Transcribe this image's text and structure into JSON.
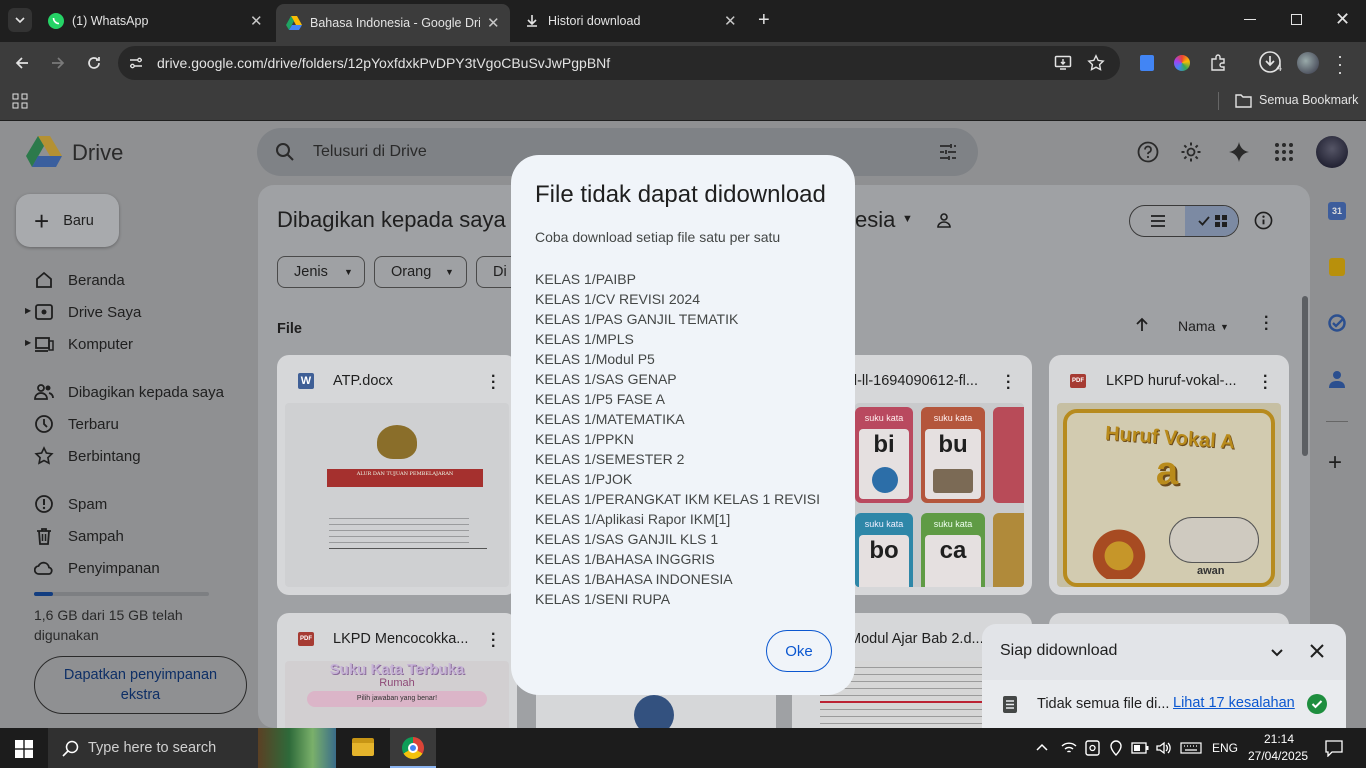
{
  "browser": {
    "tabs": [
      {
        "title": "(1) WhatsApp",
        "icon": "whatsapp-icon"
      },
      {
        "title": "Bahasa Indonesia - Google Driv",
        "icon": "google-drive-icon"
      },
      {
        "title": "Histori download",
        "icon": "download-icon"
      }
    ],
    "url": "drive.google.com/drive/folders/12pYoxfdxkPvDPY3tVgoCBuSvJwPgpBNf",
    "download_badge": "4",
    "bookmarks_label": "Semua Bookmark"
  },
  "drive": {
    "logo_text": "Drive",
    "search_placeholder": "Telusuri di Drive",
    "new_button": "Baru",
    "nav": [
      {
        "label": "Beranda",
        "icon": "home-icon"
      },
      {
        "label": "Drive Saya",
        "icon": "my-drive-icon"
      },
      {
        "label": "Komputer",
        "icon": "computer-icon"
      },
      {
        "label": "Dibagikan kepada saya",
        "icon": "shared-icon"
      },
      {
        "label": "Terbaru",
        "icon": "clock-icon"
      },
      {
        "label": "Berbintang",
        "icon": "star-icon"
      },
      {
        "label": "Spam",
        "icon": "spam-icon"
      },
      {
        "label": "Sampah",
        "icon": "trash-icon"
      },
      {
        "label": "Penyimpanan",
        "icon": "cloud-icon"
      }
    ],
    "storage_text": "1,6 GB dari 15 GB telah digunakan",
    "storage_fraction": 0.107,
    "storage_button": "Dapatkan penyimpanan ekstra",
    "breadcrumb_left": "Dibagikan kepada saya",
    "breadcrumb_right": "esia",
    "filters": [
      "Jenis",
      "Orang",
      "Di"
    ],
    "section_title": "File",
    "sort_label": "Nama",
    "files": [
      {
        "name": "ATP.docx",
        "type": "W"
      },
      {
        "name": "d-ll-1694090612-fl...",
        "type": ""
      },
      {
        "name": "LKPD huruf-vokal-...",
        "type": "PDF"
      },
      {
        "name": "LKPD Mencocokka...",
        "type": "PDF"
      },
      {
        "name": "Modul Ajar Bab 2.d...",
        "type": ""
      }
    ],
    "thumb_text": {
      "atp_line": "ALUR DAN TUJUAN PEMBELAJARAN",
      "syllables": [
        "bi",
        "bu",
        "bo",
        "ca"
      ],
      "syllable_tag": "suku kata",
      "vokal_title": "Huruf Vokal A",
      "vokal_letter": "a",
      "vokal_word": "awan",
      "mencocok_title": "Suku Kata Terbuka",
      "mencocok_sub": "Rumah",
      "mencocok_hint": "Pilih jawaban yang benar!"
    }
  },
  "dialog": {
    "title": "File tidak dapat didownload",
    "subtitle": "Coba download setiap file satu per satu",
    "items": [
      "KELAS 1/PAIBP",
      "KELAS 1/CV REVISI 2024",
      "KELAS 1/PAS GANJIL TEMATIK",
      "KELAS 1/MPLS",
      "KELAS 1/Modul P5",
      "KELAS 1/SAS GENAP",
      "KELAS 1/P5 FASE A",
      "KELAS 1/MATEMATIKA",
      "KELAS 1/PPKN",
      "KELAS 1/SEMESTER 2",
      "KELAS 1/PJOK",
      "KELAS 1/PERANGKAT IKM KELAS 1 REVISI",
      "KELAS 1/Aplikasi Rapor IKM[1]",
      "KELAS 1/SAS GANJIL KLS 1",
      "KELAS 1/BAHASA INGGRIS",
      "KELAS 1/BAHASA INDONESIA",
      "KELAS 1/SENI RUPA"
    ],
    "ok_label": "Oke"
  },
  "download_panel": {
    "title": "Siap didownload",
    "status": "Tidak semua file di...",
    "link": "Lihat 17 kesalahan"
  },
  "taskbar": {
    "search_placeholder": "Type here to search",
    "lang": "ENG",
    "time": "21:14",
    "date": "27/04/2025"
  },
  "colors": {
    "accent": "#0b57d0",
    "dialog_bg": "#f0f4f9",
    "scrim_page": "#8f9092",
    "success": "#1e8e3e"
  }
}
